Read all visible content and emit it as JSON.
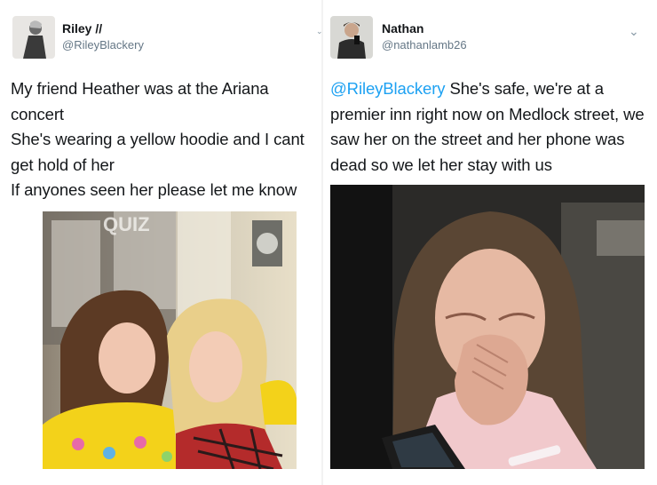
{
  "tweets": [
    {
      "name": "Riley //",
      "handle": "@RileyBlackery",
      "lines": [
        "My friend Heather was at the Ariana concert",
        "She's wearing a yellow hoodie and I cant get hold of her",
        "If anyones seen her please let me know"
      ],
      "photo_sign": "QUIZ",
      "icons": {
        "avatar": "profile-photo",
        "menu": "chevron-down-icon"
      }
    },
    {
      "name": "Nathan",
      "handle": "@nathanlamb26",
      "mention": "@RileyBlackery",
      "text": " She's safe, we're at a premier inn right now on Medlock street, we saw her on the street and her phone was dead so we let her stay with us",
      "icons": {
        "avatar": "profile-photo",
        "menu": "chevron-down-icon"
      }
    }
  ],
  "colors": {
    "link": "#1da1f2",
    "handle": "#657786",
    "text": "#14171a"
  }
}
